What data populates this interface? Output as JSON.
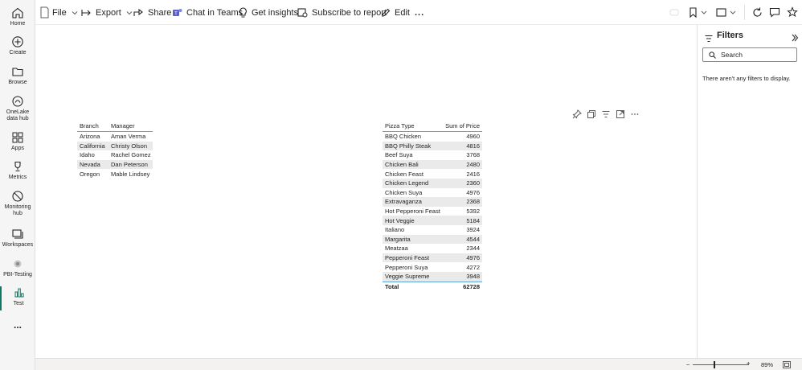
{
  "nav": {
    "items": [
      {
        "label": "Home",
        "icon": "home-icon"
      },
      {
        "label": "Create",
        "icon": "plus-circle-icon"
      },
      {
        "label": "Browse",
        "icon": "folder-icon"
      },
      {
        "label": "OneLake data hub",
        "icon": "onelake-icon"
      },
      {
        "label": "Apps",
        "icon": "apps-icon"
      },
      {
        "label": "Metrics",
        "icon": "trophy-icon"
      },
      {
        "label": "Monitoring hub",
        "icon": "monitor-icon"
      },
      {
        "label": "Workspaces",
        "icon": "workspaces-icon"
      },
      {
        "label": "PBI-Testing",
        "icon": "workspace-icon"
      },
      {
        "label": "Test",
        "icon": "report-icon"
      }
    ],
    "more": "..."
  },
  "toolbar": {
    "file": "File",
    "export": "Export",
    "share": "Share",
    "chat": "Chat in Teams",
    "insights": "Get insights",
    "subscribe": "Subscribe to report",
    "edit": "Edit",
    "more": "..."
  },
  "branch_table": {
    "headers": [
      "Branch",
      "Manager"
    ],
    "rows": [
      [
        "Arizona",
        "Aman Verma"
      ],
      [
        "California",
        "Christy Olson"
      ],
      [
        "Idaho",
        "Rachel Gomez"
      ],
      [
        "Nevada",
        "Dan Peterson"
      ],
      [
        "Oregon",
        "Mable Lindsey"
      ]
    ]
  },
  "pizza_table": {
    "headers": [
      "Pizza Type",
      "Sum of Price"
    ],
    "rows": [
      [
        "BBQ Chicken",
        "4960"
      ],
      [
        "BBQ Philly Steak",
        "4816"
      ],
      [
        "Beef Suya",
        "3768"
      ],
      [
        "Chicken Bali",
        "2480"
      ],
      [
        "Chicken Feast",
        "2416"
      ],
      [
        "Chicken Legend",
        "2360"
      ],
      [
        "Chicken Suya",
        "4976"
      ],
      [
        "Extravaganza",
        "2368"
      ],
      [
        "Hot Pepperoni Feast",
        "5392"
      ],
      [
        "Hot Veggie",
        "5184"
      ],
      [
        "Italiano",
        "3924"
      ],
      [
        "Margarita",
        "4544"
      ],
      [
        "Meatzaa",
        "2344"
      ],
      [
        "Pepperoni Feast",
        "4976"
      ],
      [
        "Pepperoni Suya",
        "4272"
      ],
      [
        "Veggie Supreme",
        "3948"
      ]
    ],
    "total_label": "Total",
    "total_value": "62728"
  },
  "filters": {
    "title": "Filters",
    "search_placeholder": "Search",
    "empty_message": "There aren't any filters to display."
  },
  "status": {
    "zoom": "89%"
  },
  "colors": {
    "accent": "#117865",
    "table_rule": "#5fa5d9",
    "row_shade": "#eaeaea"
  }
}
